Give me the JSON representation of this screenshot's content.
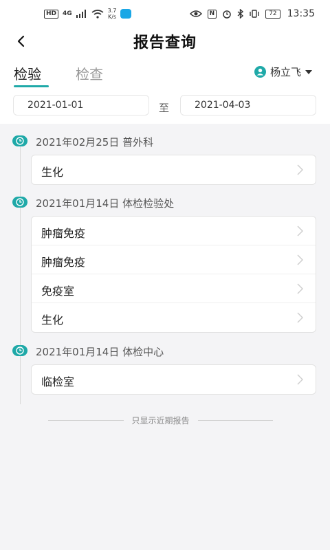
{
  "status_bar": {
    "hd": "HD",
    "network": "4G",
    "speed_value": "3.7",
    "speed_unit": "K/s",
    "nfc": "N",
    "battery": "72",
    "time": "13:35"
  },
  "header": {
    "title": "报告查询"
  },
  "tabs": [
    {
      "label": "检验",
      "active": true
    },
    {
      "label": "检查",
      "active": false
    }
  ],
  "user": {
    "name": "杨立飞"
  },
  "date_range": {
    "start": "2021-01-01",
    "separator": "至",
    "end": "2021-04-03"
  },
  "groups": [
    {
      "title": "2021年02月25日 普外科",
      "items": [
        "生化"
      ]
    },
    {
      "title": "2021年01月14日 体检检验处",
      "items": [
        "肿瘤免疫",
        "肿瘤免疫",
        "免疫室",
        "生化"
      ]
    },
    {
      "title": "2021年01月14日 体检中心",
      "items": [
        "临检室"
      ]
    }
  ],
  "footer": {
    "note": "只显示近期报告"
  },
  "colors": {
    "accent": "#1fa9a8",
    "background": "#f4f4f6"
  }
}
